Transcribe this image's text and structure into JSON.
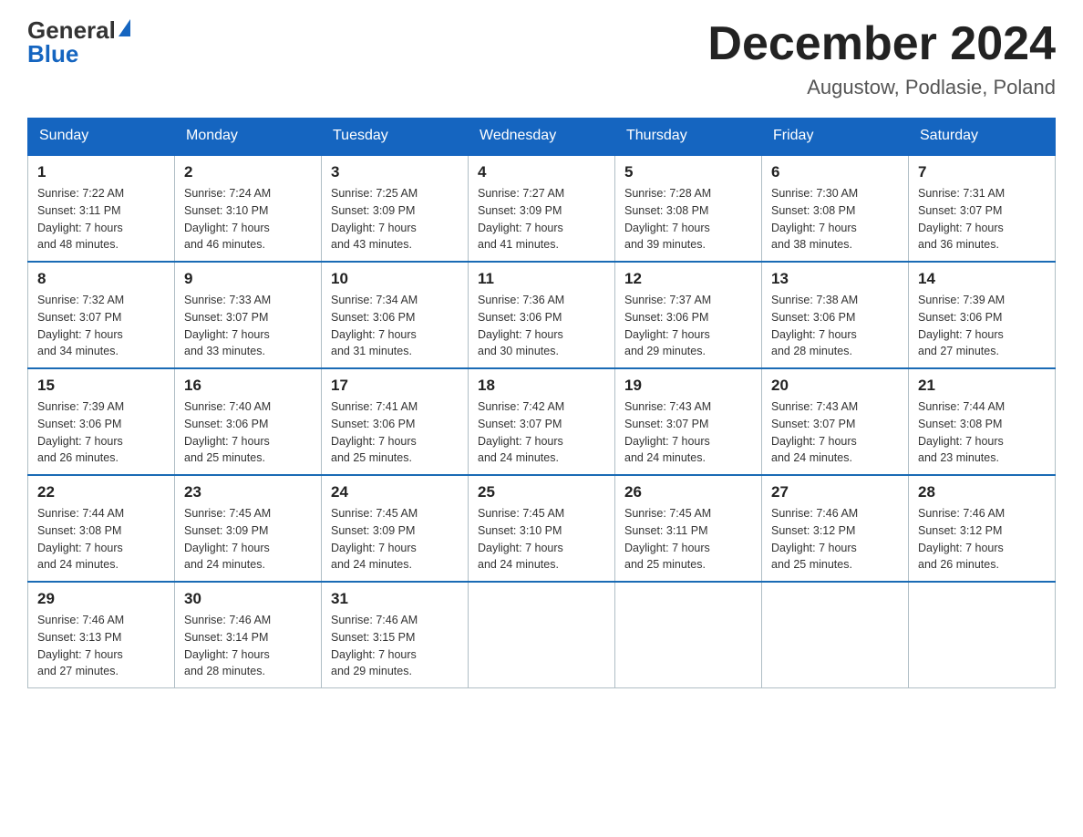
{
  "header": {
    "logo_general": "General",
    "logo_blue": "Blue",
    "month_title": "December 2024",
    "location": "Augustow, Podlasie, Poland"
  },
  "weekdays": [
    "Sunday",
    "Monday",
    "Tuesday",
    "Wednesday",
    "Thursday",
    "Friday",
    "Saturday"
  ],
  "weeks": [
    [
      {
        "day": "1",
        "sunrise": "7:22 AM",
        "sunset": "3:11 PM",
        "daylight": "7 hours and 48 minutes."
      },
      {
        "day": "2",
        "sunrise": "7:24 AM",
        "sunset": "3:10 PM",
        "daylight": "7 hours and 46 minutes."
      },
      {
        "day": "3",
        "sunrise": "7:25 AM",
        "sunset": "3:09 PM",
        "daylight": "7 hours and 43 minutes."
      },
      {
        "day": "4",
        "sunrise": "7:27 AM",
        "sunset": "3:09 PM",
        "daylight": "7 hours and 41 minutes."
      },
      {
        "day": "5",
        "sunrise": "7:28 AM",
        "sunset": "3:08 PM",
        "daylight": "7 hours and 39 minutes."
      },
      {
        "day": "6",
        "sunrise": "7:30 AM",
        "sunset": "3:08 PM",
        "daylight": "7 hours and 38 minutes."
      },
      {
        "day": "7",
        "sunrise": "7:31 AM",
        "sunset": "3:07 PM",
        "daylight": "7 hours and 36 minutes."
      }
    ],
    [
      {
        "day": "8",
        "sunrise": "7:32 AM",
        "sunset": "3:07 PM",
        "daylight": "7 hours and 34 minutes."
      },
      {
        "day": "9",
        "sunrise": "7:33 AM",
        "sunset": "3:07 PM",
        "daylight": "7 hours and 33 minutes."
      },
      {
        "day": "10",
        "sunrise": "7:34 AM",
        "sunset": "3:06 PM",
        "daylight": "7 hours and 31 minutes."
      },
      {
        "day": "11",
        "sunrise": "7:36 AM",
        "sunset": "3:06 PM",
        "daylight": "7 hours and 30 minutes."
      },
      {
        "day": "12",
        "sunrise": "7:37 AM",
        "sunset": "3:06 PM",
        "daylight": "7 hours and 29 minutes."
      },
      {
        "day": "13",
        "sunrise": "7:38 AM",
        "sunset": "3:06 PM",
        "daylight": "7 hours and 28 minutes."
      },
      {
        "day": "14",
        "sunrise": "7:39 AM",
        "sunset": "3:06 PM",
        "daylight": "7 hours and 27 minutes."
      }
    ],
    [
      {
        "day": "15",
        "sunrise": "7:39 AM",
        "sunset": "3:06 PM",
        "daylight": "7 hours and 26 minutes."
      },
      {
        "day": "16",
        "sunrise": "7:40 AM",
        "sunset": "3:06 PM",
        "daylight": "7 hours and 25 minutes."
      },
      {
        "day": "17",
        "sunrise": "7:41 AM",
        "sunset": "3:06 PM",
        "daylight": "7 hours and 25 minutes."
      },
      {
        "day": "18",
        "sunrise": "7:42 AM",
        "sunset": "3:07 PM",
        "daylight": "7 hours and 24 minutes."
      },
      {
        "day": "19",
        "sunrise": "7:43 AM",
        "sunset": "3:07 PM",
        "daylight": "7 hours and 24 minutes."
      },
      {
        "day": "20",
        "sunrise": "7:43 AM",
        "sunset": "3:07 PM",
        "daylight": "7 hours and 24 minutes."
      },
      {
        "day": "21",
        "sunrise": "7:44 AM",
        "sunset": "3:08 PM",
        "daylight": "7 hours and 23 minutes."
      }
    ],
    [
      {
        "day": "22",
        "sunrise": "7:44 AM",
        "sunset": "3:08 PM",
        "daylight": "7 hours and 24 minutes."
      },
      {
        "day": "23",
        "sunrise": "7:45 AM",
        "sunset": "3:09 PM",
        "daylight": "7 hours and 24 minutes."
      },
      {
        "day": "24",
        "sunrise": "7:45 AM",
        "sunset": "3:09 PM",
        "daylight": "7 hours and 24 minutes."
      },
      {
        "day": "25",
        "sunrise": "7:45 AM",
        "sunset": "3:10 PM",
        "daylight": "7 hours and 24 minutes."
      },
      {
        "day": "26",
        "sunrise": "7:45 AM",
        "sunset": "3:11 PM",
        "daylight": "7 hours and 25 minutes."
      },
      {
        "day": "27",
        "sunrise": "7:46 AM",
        "sunset": "3:12 PM",
        "daylight": "7 hours and 25 minutes."
      },
      {
        "day": "28",
        "sunrise": "7:46 AM",
        "sunset": "3:12 PM",
        "daylight": "7 hours and 26 minutes."
      }
    ],
    [
      {
        "day": "29",
        "sunrise": "7:46 AM",
        "sunset": "3:13 PM",
        "daylight": "7 hours and 27 minutes."
      },
      {
        "day": "30",
        "sunrise": "7:46 AM",
        "sunset": "3:14 PM",
        "daylight": "7 hours and 28 minutes."
      },
      {
        "day": "31",
        "sunrise": "7:46 AM",
        "sunset": "3:15 PM",
        "daylight": "7 hours and 29 minutes."
      },
      null,
      null,
      null,
      null
    ]
  ],
  "labels": {
    "sunrise": "Sunrise:",
    "sunset": "Sunset:",
    "daylight": "Daylight:"
  }
}
